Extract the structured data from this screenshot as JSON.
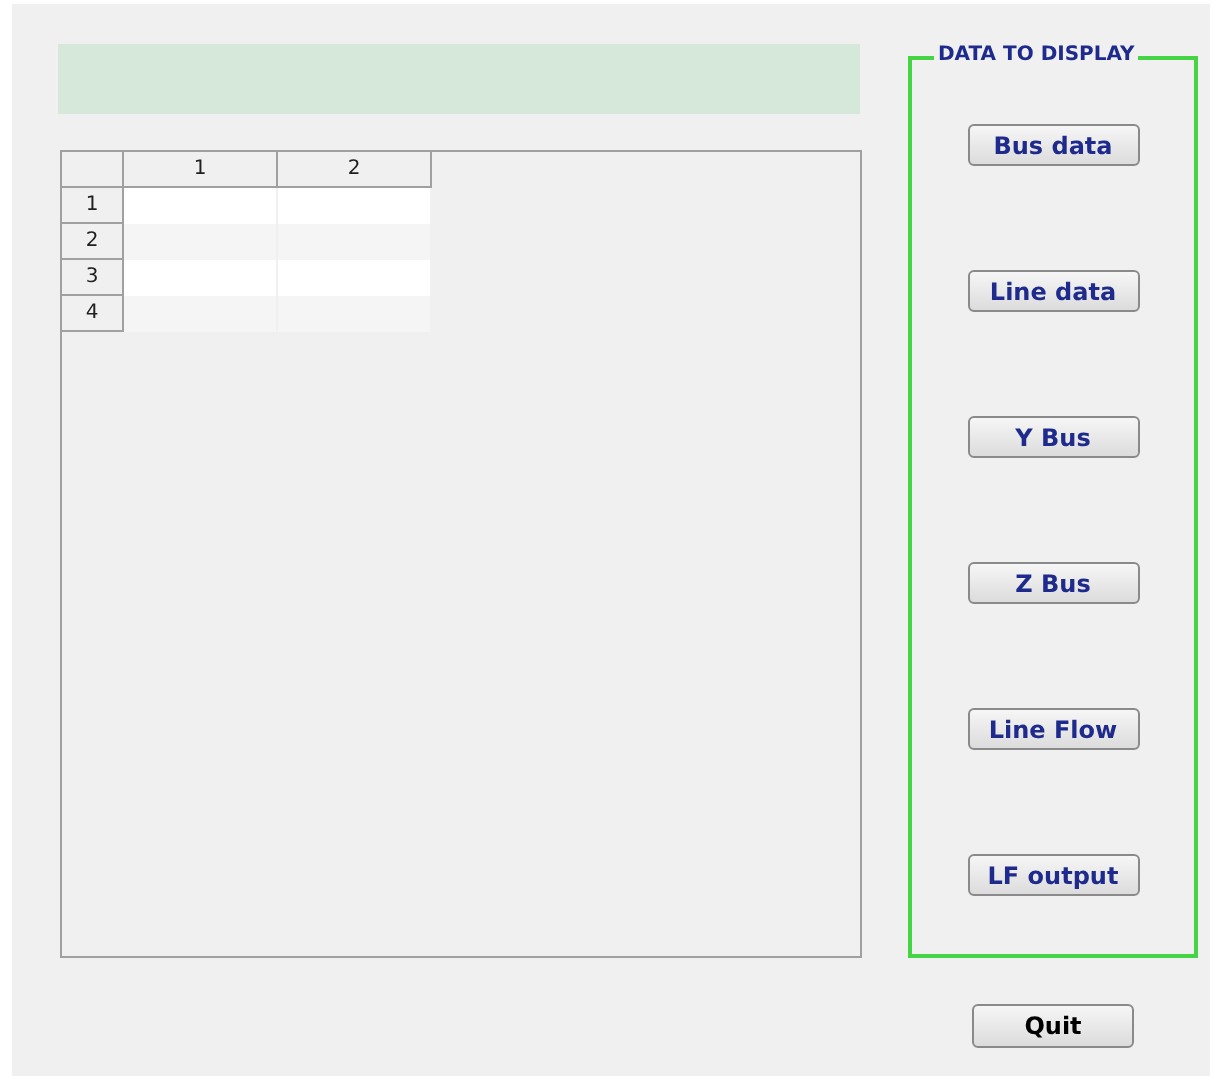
{
  "status_bar_text": {
    "kind": "banner"
  },
  "table": {
    "columns": [
      "1",
      "2"
    ],
    "rows": [
      {
        "label": "1"
      },
      {
        "label": "2"
      },
      {
        "label": "3"
      },
      {
        "label": "4"
      }
    ]
  },
  "panel": {
    "title": "DATA TO DISPLAY",
    "buttons": [
      "Bus data",
      "Line data",
      "Y Bus",
      "Z Bus",
      "Line Flow",
      "LF output"
    ]
  },
  "quit_button": "Quit"
}
